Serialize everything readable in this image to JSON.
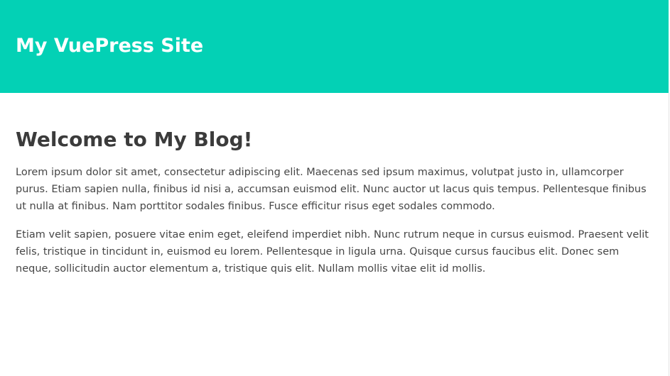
{
  "header": {
    "site_title": "My VuePress Site",
    "background_color": "#03d1b5"
  },
  "main": {
    "heading": "Welcome to My Blog!",
    "paragraphs": [
      "Lorem ipsum dolor sit amet, consectetur adipiscing elit. Maecenas sed ipsum maximus, volutpat justo in, ullamcorper purus. Etiam sapien nulla, finibus id nisi a, accumsan euismod elit. Nunc auctor ut lacus quis tempus. Pellentesque finibus ut nulla at finibus. Nam porttitor sodales finibus. Fusce efficitur risus eget sodales commodo.",
      "Etiam velit sapien, posuere vitae enim eget, eleifend imperdiet nibh. Nunc rutrum neque in cursus euismod. Praesent velit felis, tristique in tincidunt in, euismod eu lorem. Pellentesque in ligula urna. Quisque cursus faucibus elit. Donec sem neque, sollicitudin auctor elementum a, tristique quis elit. Nullam mollis vitae elit id mollis."
    ]
  }
}
